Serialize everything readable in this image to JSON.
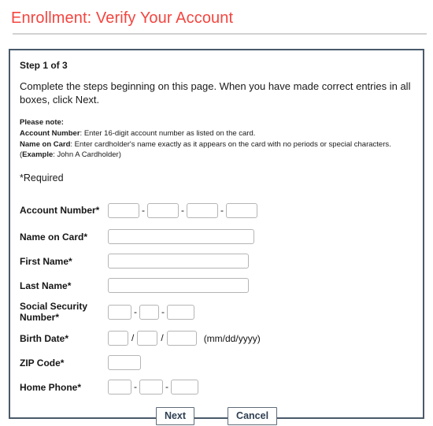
{
  "header": {
    "title": "Enrollment: Verify Your Account",
    "title_color": "#f4453f"
  },
  "panel": {
    "step_heading": "Step 1 of 3",
    "intro": "Complete the steps beginning on this page. When you have made correct entries in all boxes, click Next.",
    "note": {
      "heading": "Please note:",
      "account_number_label": "Account Number",
      "account_number_text": ": Enter 16-digit account number as listed on the card.",
      "name_on_card_label": "Name on Card",
      "name_on_card_text": ": Enter cardholder's name exactly as it appears on the card with no periods or special characters. (",
      "example_label": "Example",
      "example_text": ": John A Cardholder)"
    },
    "required_note": "*Required"
  },
  "form": {
    "rows": [
      {
        "label": "Account Number*"
      },
      {
        "label": "Name on Card*"
      },
      {
        "label": "First Name*"
      },
      {
        "label": "Last Name*"
      },
      {
        "label": "Social Security Number*"
      },
      {
        "label": "Birth Date*"
      },
      {
        "label": "ZIP Code*"
      },
      {
        "label": "Home Phone*"
      }
    ],
    "separators": {
      "dash": "-",
      "slash": "/"
    },
    "birth_date_hint": "(mm/dd/yyyy)",
    "values": {
      "account_1": "",
      "account_2": "",
      "account_3": "",
      "account_4": "",
      "name_on_card": "",
      "first_name": "",
      "last_name": "",
      "ssn_1": "",
      "ssn_2": "",
      "ssn_3": "",
      "birth_mm": "",
      "birth_dd": "",
      "birth_yyyy": "",
      "zip": "",
      "phone_1": "",
      "phone_2": "",
      "phone_3": ""
    }
  },
  "buttons": {
    "next": "Next",
    "cancel": "Cancel"
  }
}
